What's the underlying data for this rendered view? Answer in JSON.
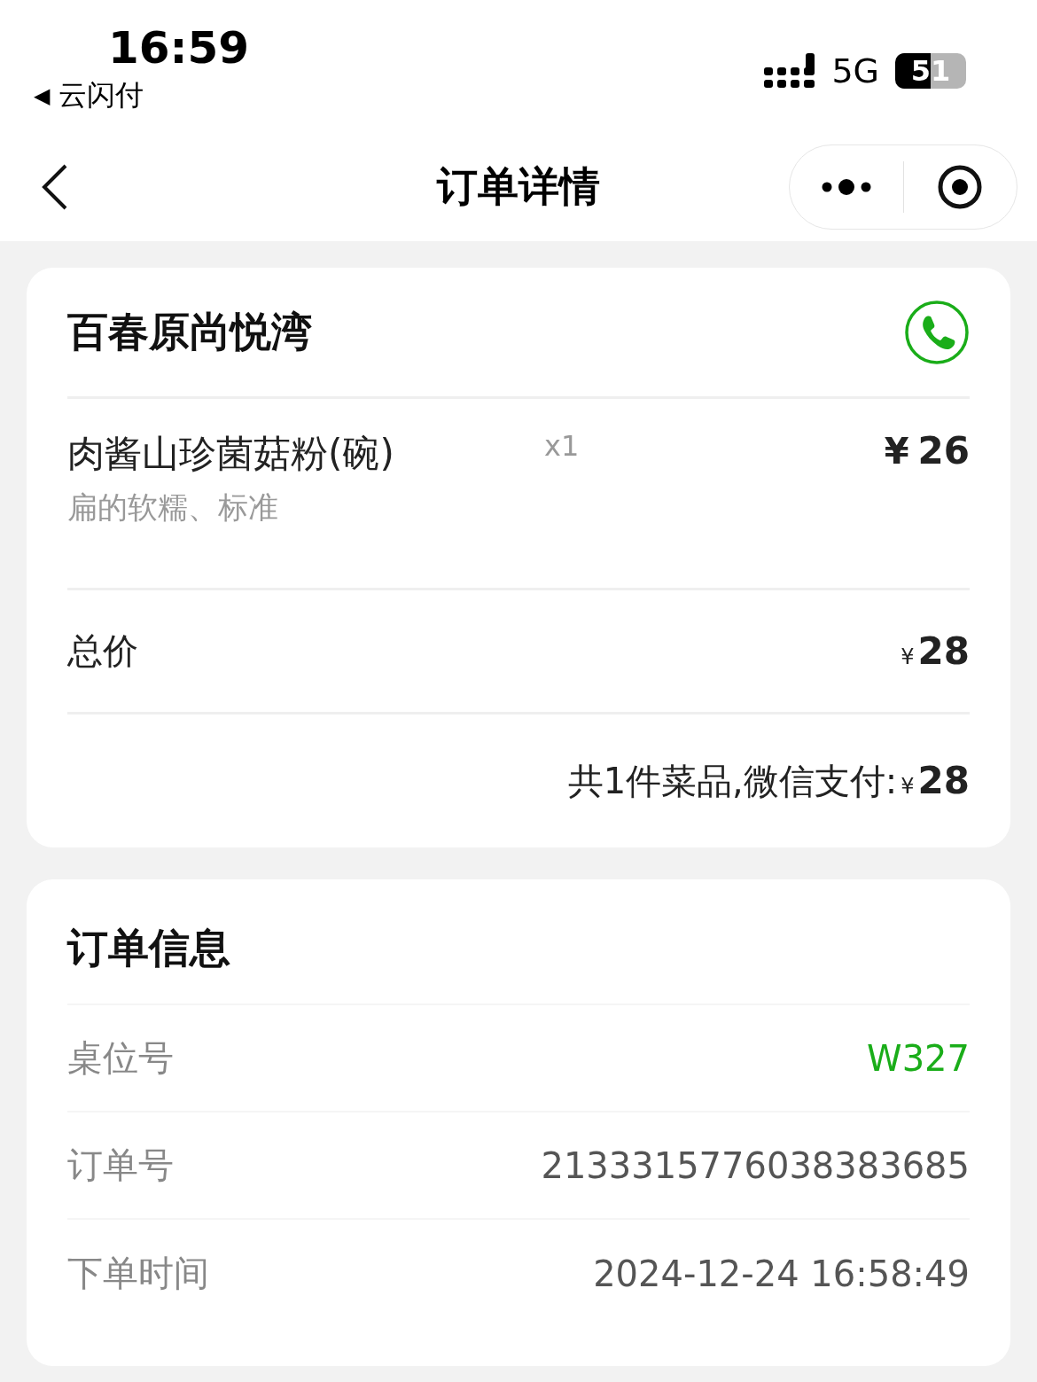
{
  "status_bar": {
    "time": "16:59",
    "back_app": "云闪付",
    "back_arrow": "◀",
    "network": "5G",
    "battery": "51"
  },
  "nav": {
    "title": "订单详情"
  },
  "store": {
    "name": "百春原尚悦湾",
    "items": [
      {
        "name": "肉酱山珍菌菇粉(碗)",
        "options": "扁的软糯、标准",
        "quantity": "x1",
        "currency": "¥",
        "price": "26"
      }
    ],
    "total": {
      "label": "总价",
      "currency": "¥",
      "amount": "28"
    },
    "summary": {
      "text": "共1件菜品,微信支付:",
      "currency": "¥",
      "amount": "28"
    }
  },
  "order_info": {
    "title": "订单信息",
    "rows": [
      {
        "label": "桌位号",
        "value": "W327",
        "color": "#1aad19"
      },
      {
        "label": "订单号",
        "value": "2133315776038383685",
        "color": "#555555"
      },
      {
        "label": "下单时间",
        "value": "2024-12-24 16:58:49",
        "color": "#555555"
      }
    ]
  }
}
